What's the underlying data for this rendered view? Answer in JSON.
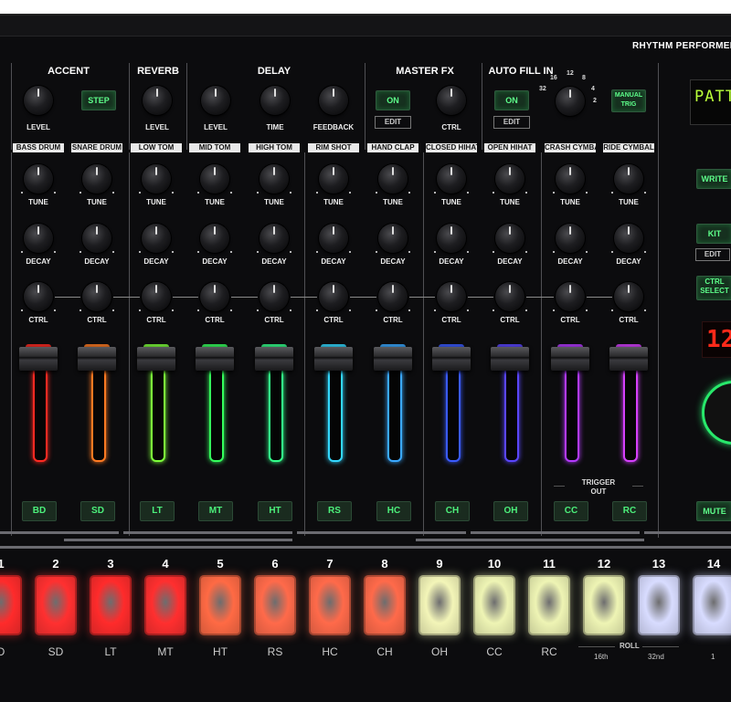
{
  "brand": "RHYTHM PERFORMER",
  "sections": {
    "accent": "ACCENT",
    "reverb": "REVERB",
    "delay": "DELAY",
    "master_fx": "MASTER FX",
    "auto_fill": "AUTO FILL IN"
  },
  "knob_labels": {
    "level": "LEVEL",
    "time": "TIME",
    "feedback": "FEEDBACK",
    "ctrl": "CTRL",
    "tune": "TUNE",
    "decay": "DECAY"
  },
  "buttons": {
    "step": "STEP",
    "fx_on": "ON",
    "fill_on": "ON",
    "edit": "EDIT",
    "manual_trig": "MANUAL TRIG",
    "write": "WRITE",
    "kit": "KIT",
    "ctrl_select": "CTRL SELECT",
    "mute": "MUTE"
  },
  "autofill_scale": [
    "2",
    "4",
    "8",
    "12",
    "16",
    "32"
  ],
  "display_text": "PATT",
  "led_readout": "12",
  "channels": [
    {
      "name": "BASS DRUM",
      "code": "BD",
      "color": "#ff2a22"
    },
    {
      "name": "SNARE DRUM",
      "code": "SD",
      "color": "#ff7a22"
    },
    {
      "name": "LOW TOM",
      "code": "LT",
      "color": "#7dff3a"
    },
    {
      "name": "MID TOM",
      "code": "MT",
      "color": "#34ff5c"
    },
    {
      "name": "HIGH TOM",
      "code": "HT",
      "color": "#33ff8a"
    },
    {
      "name": "RIM SHOT",
      "code": "RS",
      "color": "#33d8ff"
    },
    {
      "name": "HAND CLAP",
      "code": "HC",
      "color": "#3aa9ff"
    },
    {
      "name": "CLOSED HIHAT",
      "code": "CH",
      "color": "#3a5bff"
    },
    {
      "name": "OPEN HIHAT",
      "code": "OH",
      "color": "#5a46ff"
    },
    {
      "name": "CRASH CYMBAL",
      "code": "CC",
      "color": "#b43aff"
    },
    {
      "name": "RIDE CYMBAL",
      "code": "RC",
      "color": "#d640ff"
    }
  ],
  "trigger_out": {
    "line1": "TRIGGER",
    "line2": "OUT"
  },
  "pads": [
    {
      "num": "1",
      "label": "D",
      "color": "#ff2b2b"
    },
    {
      "num": "2",
      "label": "SD",
      "color": "#ff3030"
    },
    {
      "num": "3",
      "label": "LT",
      "color": "#ff2b2b"
    },
    {
      "num": "4",
      "label": "MT",
      "color": "#ff2f2f"
    },
    {
      "num": "5",
      "label": "HT",
      "color": "#ff6a44"
    },
    {
      "num": "6",
      "label": "RS",
      "color": "#ff6a4a"
    },
    {
      "num": "7",
      "label": "HC",
      "color": "#ff6a4a"
    },
    {
      "num": "8",
      "label": "CH",
      "color": "#ff6a4a"
    },
    {
      "num": "9",
      "label": "OH",
      "color": "#f3f5b8"
    },
    {
      "num": "10",
      "label": "CC",
      "color": "#eef4b4"
    },
    {
      "num": "11",
      "label": "RC",
      "color": "#eef4b4"
    },
    {
      "num": "12",
      "label": "",
      "color": "#eef4b4"
    },
    {
      "num": "13",
      "label": "",
      "color": "#d8dcff"
    },
    {
      "num": "14",
      "label": "",
      "color": "#d8dcff"
    }
  ],
  "roll": {
    "title": "ROLL",
    "a": "16th",
    "b": "32nd",
    "c": "1"
  },
  "colors": {
    "panel": "#0c0c0e",
    "green_led": "#5dff8a",
    "red_led": "#ff2a1a"
  }
}
